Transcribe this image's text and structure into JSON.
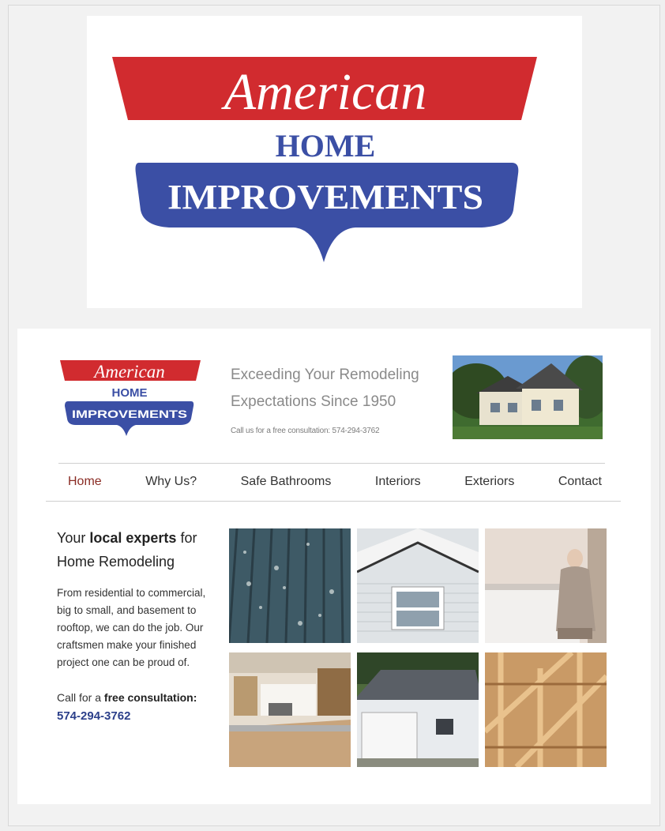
{
  "big_logo": {
    "line1": "American",
    "line2": "HOME",
    "line3": "IMPROVEMENTS"
  },
  "site": {
    "logo": {
      "line1": "American",
      "line2": "HOME",
      "line3": "IMPROVEMENTS"
    },
    "tagline_line1": "Exceeding Your Remodeling",
    "tagline_line2": "Expectations Since 1950",
    "call_us": "Call us for a free consultation: 574-294-3762",
    "nav": [
      {
        "label": "Home",
        "active": true
      },
      {
        "label": "Why Us?"
      },
      {
        "label": "Safe Bathrooms"
      },
      {
        "label": "Interiors"
      },
      {
        "label": "Exteriors"
      },
      {
        "label": "Contact"
      }
    ],
    "intro": {
      "title_pre": "Your ",
      "title_bold": "local experts",
      "title_post": " for",
      "title_line2": "Home Remodeling",
      "body": "From residential to commercial, big to small, and basement to rooftop, we can do the job. Our craftsmen make your finished project one can be proud of.",
      "call_pre": "Call for a ",
      "call_bold": "free consultation:",
      "phone": "574-294-3762"
    }
  },
  "colors": {
    "brand_red": "#d12b2f",
    "brand_blue": "#3b4fa5",
    "nav_active": "#8a2c24",
    "phone_blue": "#2b3f8a"
  },
  "images": [
    "house-photo",
    "deck-photo",
    "siding-photo",
    "bathroom-photo",
    "kitchen-photo",
    "garage-photo",
    "framing-photo"
  ]
}
